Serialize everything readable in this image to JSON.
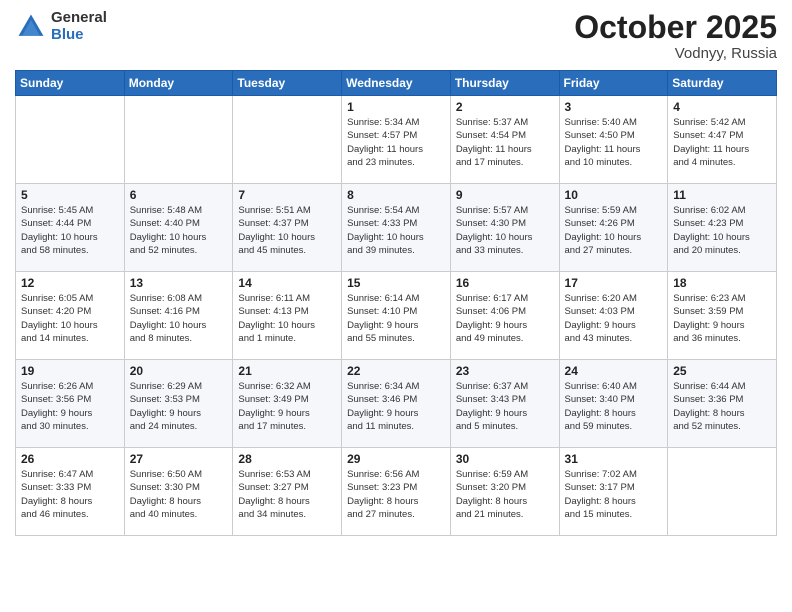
{
  "logo": {
    "general": "General",
    "blue": "Blue"
  },
  "header": {
    "month": "October 2025",
    "location": "Vodnyy, Russia"
  },
  "weekdays": [
    "Sunday",
    "Monday",
    "Tuesday",
    "Wednesday",
    "Thursday",
    "Friday",
    "Saturday"
  ],
  "weeks": [
    [
      {
        "day": "",
        "info": ""
      },
      {
        "day": "",
        "info": ""
      },
      {
        "day": "",
        "info": ""
      },
      {
        "day": "1",
        "info": "Sunrise: 5:34 AM\nSunset: 4:57 PM\nDaylight: 11 hours\nand 23 minutes."
      },
      {
        "day": "2",
        "info": "Sunrise: 5:37 AM\nSunset: 4:54 PM\nDaylight: 11 hours\nand 17 minutes."
      },
      {
        "day": "3",
        "info": "Sunrise: 5:40 AM\nSunset: 4:50 PM\nDaylight: 11 hours\nand 10 minutes."
      },
      {
        "day": "4",
        "info": "Sunrise: 5:42 AM\nSunset: 4:47 PM\nDaylight: 11 hours\nand 4 minutes."
      }
    ],
    [
      {
        "day": "5",
        "info": "Sunrise: 5:45 AM\nSunset: 4:44 PM\nDaylight: 10 hours\nand 58 minutes."
      },
      {
        "day": "6",
        "info": "Sunrise: 5:48 AM\nSunset: 4:40 PM\nDaylight: 10 hours\nand 52 minutes."
      },
      {
        "day": "7",
        "info": "Sunrise: 5:51 AM\nSunset: 4:37 PM\nDaylight: 10 hours\nand 45 minutes."
      },
      {
        "day": "8",
        "info": "Sunrise: 5:54 AM\nSunset: 4:33 PM\nDaylight: 10 hours\nand 39 minutes."
      },
      {
        "day": "9",
        "info": "Sunrise: 5:57 AM\nSunset: 4:30 PM\nDaylight: 10 hours\nand 33 minutes."
      },
      {
        "day": "10",
        "info": "Sunrise: 5:59 AM\nSunset: 4:26 PM\nDaylight: 10 hours\nand 27 minutes."
      },
      {
        "day": "11",
        "info": "Sunrise: 6:02 AM\nSunset: 4:23 PM\nDaylight: 10 hours\nand 20 minutes."
      }
    ],
    [
      {
        "day": "12",
        "info": "Sunrise: 6:05 AM\nSunset: 4:20 PM\nDaylight: 10 hours\nand 14 minutes."
      },
      {
        "day": "13",
        "info": "Sunrise: 6:08 AM\nSunset: 4:16 PM\nDaylight: 10 hours\nand 8 minutes."
      },
      {
        "day": "14",
        "info": "Sunrise: 6:11 AM\nSunset: 4:13 PM\nDaylight: 10 hours\nand 1 minute."
      },
      {
        "day": "15",
        "info": "Sunrise: 6:14 AM\nSunset: 4:10 PM\nDaylight: 9 hours\nand 55 minutes."
      },
      {
        "day": "16",
        "info": "Sunrise: 6:17 AM\nSunset: 4:06 PM\nDaylight: 9 hours\nand 49 minutes."
      },
      {
        "day": "17",
        "info": "Sunrise: 6:20 AM\nSunset: 4:03 PM\nDaylight: 9 hours\nand 43 minutes."
      },
      {
        "day": "18",
        "info": "Sunrise: 6:23 AM\nSunset: 3:59 PM\nDaylight: 9 hours\nand 36 minutes."
      }
    ],
    [
      {
        "day": "19",
        "info": "Sunrise: 6:26 AM\nSunset: 3:56 PM\nDaylight: 9 hours\nand 30 minutes."
      },
      {
        "day": "20",
        "info": "Sunrise: 6:29 AM\nSunset: 3:53 PM\nDaylight: 9 hours\nand 24 minutes."
      },
      {
        "day": "21",
        "info": "Sunrise: 6:32 AM\nSunset: 3:49 PM\nDaylight: 9 hours\nand 17 minutes."
      },
      {
        "day": "22",
        "info": "Sunrise: 6:34 AM\nSunset: 3:46 PM\nDaylight: 9 hours\nand 11 minutes."
      },
      {
        "day": "23",
        "info": "Sunrise: 6:37 AM\nSunset: 3:43 PM\nDaylight: 9 hours\nand 5 minutes."
      },
      {
        "day": "24",
        "info": "Sunrise: 6:40 AM\nSunset: 3:40 PM\nDaylight: 8 hours\nand 59 minutes."
      },
      {
        "day": "25",
        "info": "Sunrise: 6:44 AM\nSunset: 3:36 PM\nDaylight: 8 hours\nand 52 minutes."
      }
    ],
    [
      {
        "day": "26",
        "info": "Sunrise: 6:47 AM\nSunset: 3:33 PM\nDaylight: 8 hours\nand 46 minutes."
      },
      {
        "day": "27",
        "info": "Sunrise: 6:50 AM\nSunset: 3:30 PM\nDaylight: 8 hours\nand 40 minutes."
      },
      {
        "day": "28",
        "info": "Sunrise: 6:53 AM\nSunset: 3:27 PM\nDaylight: 8 hours\nand 34 minutes."
      },
      {
        "day": "29",
        "info": "Sunrise: 6:56 AM\nSunset: 3:23 PM\nDaylight: 8 hours\nand 27 minutes."
      },
      {
        "day": "30",
        "info": "Sunrise: 6:59 AM\nSunset: 3:20 PM\nDaylight: 8 hours\nand 21 minutes."
      },
      {
        "day": "31",
        "info": "Sunrise: 7:02 AM\nSunset: 3:17 PM\nDaylight: 8 hours\nand 15 minutes."
      },
      {
        "day": "",
        "info": ""
      }
    ]
  ]
}
